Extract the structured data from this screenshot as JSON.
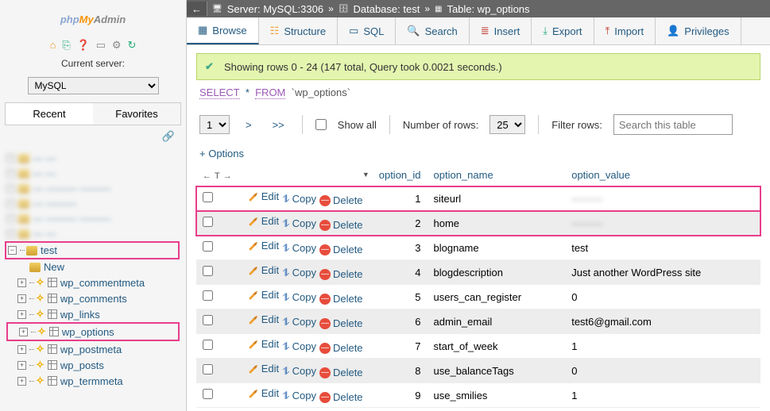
{
  "logo": {
    "php": "php",
    "my": "My",
    "admin": "Admin"
  },
  "serverLabel": "Current server:",
  "serverValue": "MySQL",
  "navTabs": {
    "recent": "Recent",
    "favorites": "Favorites"
  },
  "tree": {
    "blurred": [
      "— —",
      "— —",
      "— ——— ———",
      "— ———",
      "— ——— ———",
      "— —"
    ],
    "db": "test",
    "new": "New",
    "tables": [
      "wp_commentmeta",
      "wp_comments",
      "wp_links",
      "wp_options",
      "wp_postmeta",
      "wp_posts",
      "wp_termmeta"
    ],
    "highlightIdx": 3
  },
  "breadcrumb": {
    "server": "Server: MySQL:3306",
    "db": "Database: test",
    "table": "Table: wp_options"
  },
  "tabs": {
    "browse": "Browse",
    "structure": "Structure",
    "sql": "SQL",
    "search": "Search",
    "insert": "Insert",
    "export": "Export",
    "import": "Import",
    "privileges": "Privileges"
  },
  "message": "Showing rows 0 - 24 (147 total, Query took 0.0021 seconds.)",
  "sql": {
    "select": "SELECT",
    "star": "*",
    "from": "FROM",
    "table": "`wp_options`"
  },
  "controls": {
    "page": "1",
    "showAll": "Show all",
    "numRows": "Number of rows:",
    "rows": "25",
    "filterLabel": "Filter rows:",
    "filterPlaceholder": "Search this table"
  },
  "optionsLink": "+ Options",
  "columns": {
    "id": "option_id",
    "name": "option_name",
    "value": "option_value"
  },
  "actions": {
    "edit": "Edit",
    "copy": "Copy",
    "delete": "Delete"
  },
  "rows": [
    {
      "id": "1",
      "name": "siteurl",
      "value": "———",
      "blur": true,
      "hl": true
    },
    {
      "id": "2",
      "name": "home",
      "value": "———",
      "blur": true,
      "hl": true
    },
    {
      "id": "3",
      "name": "blogname",
      "value": "test"
    },
    {
      "id": "4",
      "name": "blogdescription",
      "value": "Just another WordPress site"
    },
    {
      "id": "5",
      "name": "users_can_register",
      "value": "0"
    },
    {
      "id": "6",
      "name": "admin_email",
      "value": "test6@gmail.com"
    },
    {
      "id": "7",
      "name": "start_of_week",
      "value": "1"
    },
    {
      "id": "8",
      "name": "use_balanceTags",
      "value": "0"
    },
    {
      "id": "9",
      "name": "use_smilies",
      "value": "1"
    }
  ]
}
